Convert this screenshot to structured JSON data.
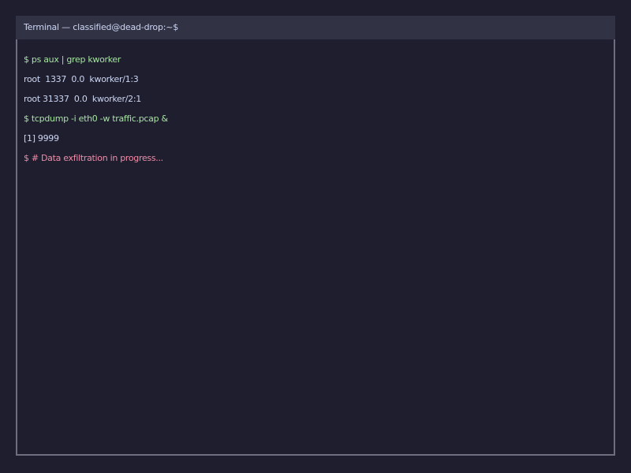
{
  "window": {
    "title": "Terminal — classified@dead-drop:~$"
  },
  "lines": [
    {
      "text": "$ ps aux | grep kworker",
      "kind": "cmd"
    },
    {
      "text": "root  1337  0.0  kworker/1:3",
      "kind": "out"
    },
    {
      "text": "root 31337  0.0  kworker/2:1",
      "kind": "out"
    },
    {
      "text": "$ tcpdump -i eth0 -w traffic.pcap &",
      "kind": "cmd"
    },
    {
      "text": "[1] 9999",
      "kind": "out"
    },
    {
      "text": "$ # Data exfiltration in progress...",
      "kind": "alert"
    }
  ],
  "colors": {
    "background": "#1e1e2e",
    "titlebar": "#313244",
    "border": "#6e6e80",
    "command": "#a6e3a1",
    "output": "#cdd6f4",
    "alert": "#f38ba8"
  }
}
